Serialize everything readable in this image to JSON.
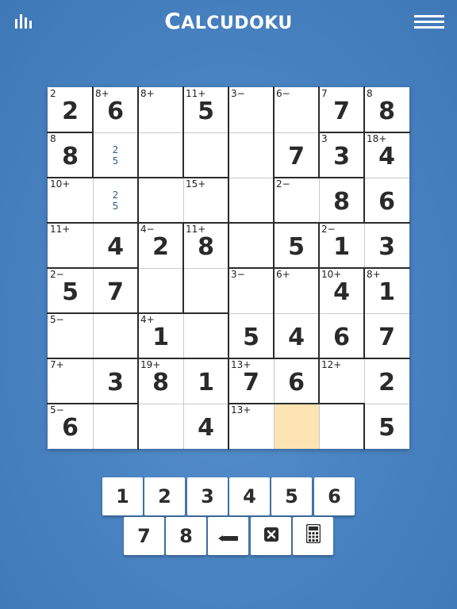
{
  "app": {
    "title_first": "C",
    "title_rest": "ALCUDOKU"
  },
  "icons": {
    "stats": "stats-icon",
    "menu": "hamburger-menu-icon",
    "erase": "eraser-icon",
    "clear": "clear-x-icon",
    "calculator": "calculator-icon"
  },
  "colors": {
    "background": "#4a84c2",
    "selected_cell": "#fde4b3",
    "notes": "#2f5c8f"
  },
  "grid": {
    "size": 8,
    "selected_cell": [
      7,
      5
    ],
    "values": [
      [
        "2",
        "6",
        "",
        "5",
        "",
        "",
        "7",
        "8"
      ],
      [
        "8",
        "",
        "",
        "",
        "",
        "7",
        "3",
        "4"
      ],
      [
        "",
        "",
        "",
        "",
        "",
        "",
        "8",
        "6"
      ],
      [
        "",
        "4",
        "2",
        "8",
        "",
        "5",
        "1",
        "3"
      ],
      [
        "5",
        "7",
        "",
        "",
        "",
        "",
        "4",
        "1"
      ],
      [
        "",
        "",
        "1",
        "",
        "5",
        "4",
        "6",
        "7"
      ],
      [
        "",
        "3",
        "8",
        "1",
        "7",
        "6",
        "",
        "2"
      ],
      [
        "6",
        "",
        "",
        "4",
        "",
        "",
        "",
        "5"
      ]
    ],
    "clues": [
      [
        "2",
        "8+",
        "8+",
        "11+",
        "3−",
        "6−",
        "7",
        "8"
      ],
      [
        "8",
        "",
        "",
        "",
        "",
        "",
        "3",
        "18+"
      ],
      [
        "10+",
        "",
        "",
        "15+",
        "",
        "2−",
        "",
        ""
      ],
      [
        "11+",
        "",
        "4−",
        "11+",
        "",
        "",
        "2−",
        ""
      ],
      [
        "2−",
        "",
        "",
        "",
        "3−",
        "6+",
        "10+",
        "8+"
      ],
      [
        "5−",
        "",
        "4+",
        "",
        "",
        "",
        "",
        ""
      ],
      [
        "7+",
        "",
        "19+",
        "",
        "13+",
        "",
        "12+",
        ""
      ],
      [
        "5−",
        "",
        "",
        "",
        "13+",
        "",
        "",
        ""
      ]
    ],
    "notes": [
      [
        "",
        "",
        "",
        "",
        "",
        "",
        "",
        ""
      ],
      [
        "",
        "25",
        "",
        "",
        "",
        "",
        "",
        ""
      ],
      [
        "",
        "25",
        "",
        "",
        "",
        "",
        "",
        ""
      ],
      [
        "",
        "",
        "",
        "",
        "",
        "",
        "",
        ""
      ],
      [
        "",
        "",
        "",
        "",
        "",
        "",
        "",
        ""
      ],
      [
        "",
        "",
        "",
        "",
        "",
        "",
        "",
        ""
      ],
      [
        "",
        "",
        "",
        "",
        "",
        "",
        "",
        ""
      ],
      [
        "",
        "",
        "",
        "",
        "",
        "",
        "",
        ""
      ]
    ],
    "cages": [
      [
        "A",
        "B",
        "C",
        "D",
        "E",
        "F",
        "G",
        "H"
      ],
      [
        "I",
        "B",
        "C",
        "D",
        "E",
        "F",
        "J",
        "K"
      ],
      [
        "L",
        "L",
        "M",
        "M",
        "E",
        "N",
        "N",
        "K"
      ],
      [
        "O",
        "O",
        "P",
        "Q",
        "R",
        "S",
        "T",
        "T"
      ],
      [
        "U",
        "U",
        "P",
        "Q",
        "V",
        "W",
        "X",
        "Y"
      ],
      [
        "Z",
        "Z",
        "AA",
        "AA",
        "V",
        "W",
        "X",
        "Y"
      ],
      [
        "AB",
        "AB",
        "AC",
        "AC",
        "AD",
        "AD",
        "AE",
        "AE"
      ],
      [
        "AF",
        "AF",
        "AC",
        "AC",
        "AG",
        "AG",
        "AG",
        "AE"
      ]
    ]
  },
  "keypad": {
    "row1": [
      "1",
      "2",
      "3",
      "4",
      "5",
      "6"
    ],
    "row2": [
      "7",
      "8"
    ]
  }
}
